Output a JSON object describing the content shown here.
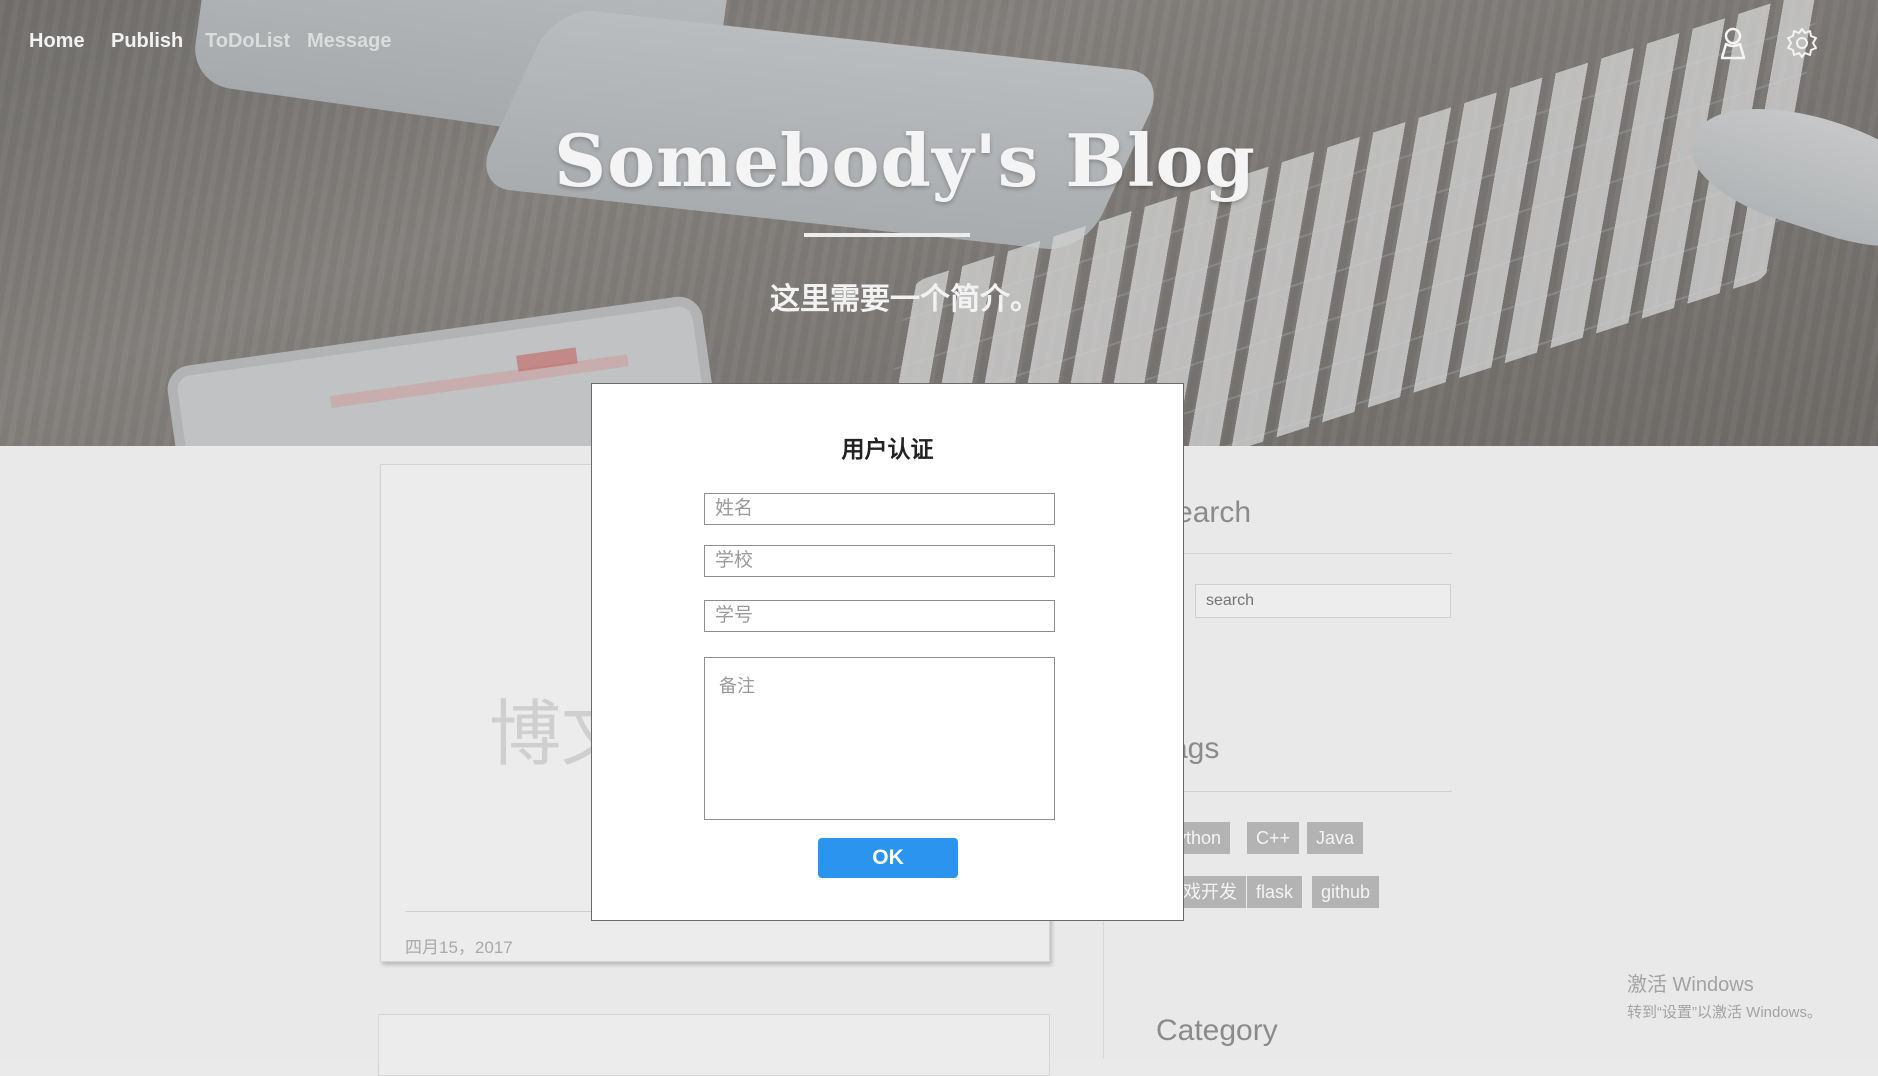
{
  "nav": {
    "links": [
      {
        "label": "Home"
      },
      {
        "label": "Publish"
      },
      {
        "label": "ToDoList"
      },
      {
        "label": "Message"
      }
    ],
    "icons": [
      "user-icon",
      "gear-icon"
    ]
  },
  "hero": {
    "title": "Somebody's Blog",
    "subtitle": "这里需要一个简介。"
  },
  "post": {
    "placeholder_text": "博文",
    "date": "四月15，2017"
  },
  "sidebar": {
    "search_heading": "Search",
    "search_placeholder": "search",
    "tags_heading": "Tags",
    "tags": [
      "Python",
      "C++",
      "Java",
      "游戏开发",
      "flask",
      "github"
    ],
    "category_heading": "Category"
  },
  "modal": {
    "title": "用户认证",
    "name_placeholder": "姓名",
    "school_placeholder": "学校",
    "student_id_placeholder": "学号",
    "note_placeholder": "备注",
    "ok_label": "OK"
  },
  "watermark": {
    "line1": "激活 Windows",
    "line2": "转到“设置”以激活 Windows。"
  },
  "colors": {
    "ok_button": "#2a94ef",
    "tag_bg": "#b3b3b3"
  }
}
